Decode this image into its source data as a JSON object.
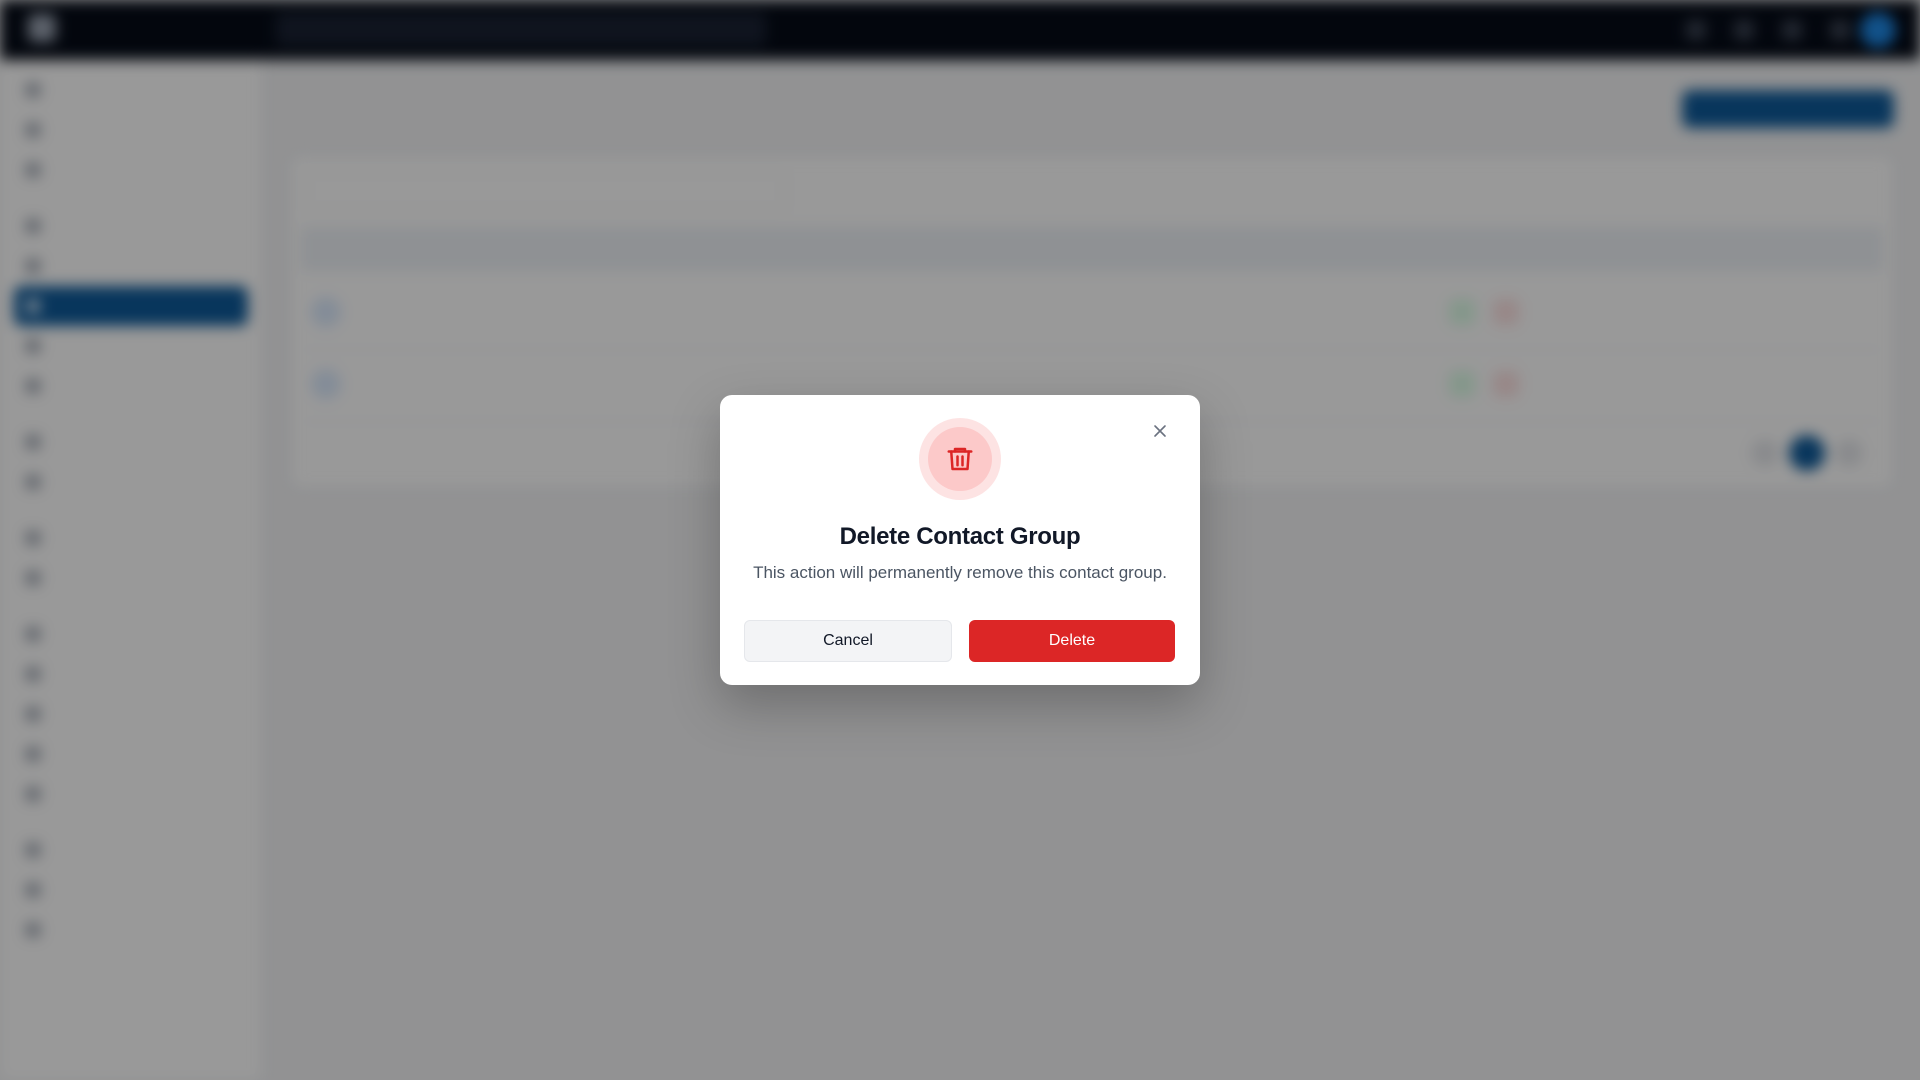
{
  "modal": {
    "title": "Delete Contact Group",
    "description": "This action will permanently remove this contact group.",
    "cancel_label": "Cancel",
    "delete_label": "Delete",
    "icon": "trash-icon",
    "close_icon": "close-icon"
  },
  "colors": {
    "danger": "#dc2626",
    "danger_soft": "#fde3e3",
    "primary": "#0e5a9a",
    "overlay": "rgba(0,0,0,0.4)"
  }
}
